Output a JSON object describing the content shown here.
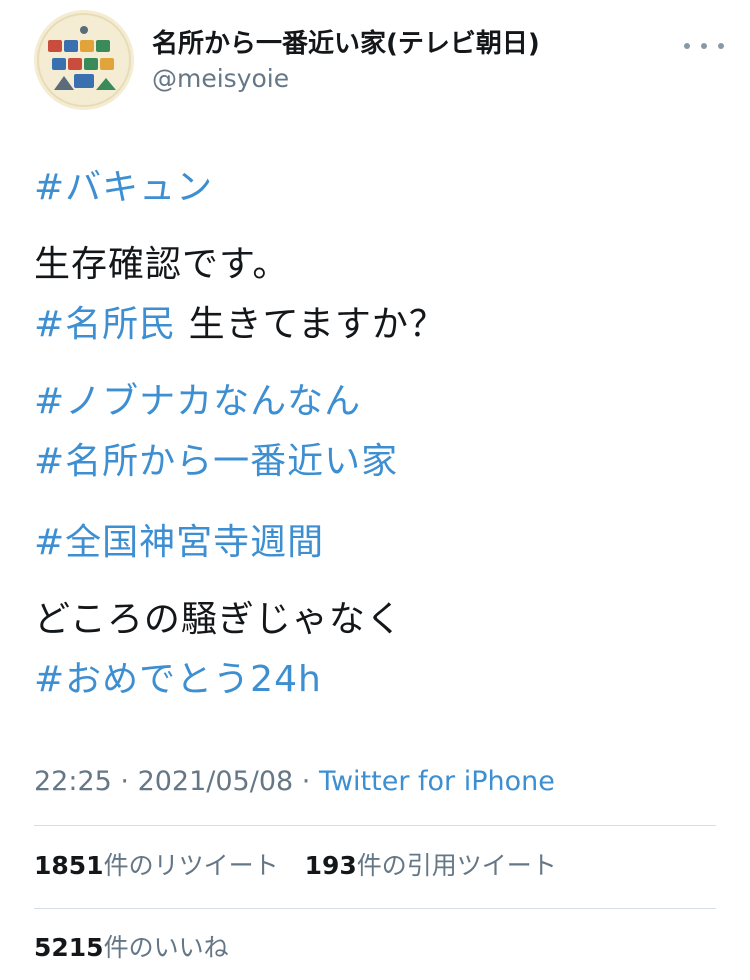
{
  "account": {
    "display_name": "名所から一番近い家(テレビ朝日)",
    "handle": "@meisyoie",
    "avatar_text": "名所から一番近い家"
  },
  "tweet": {
    "hashtag_bakyun": "#バキュン",
    "line_seizon": "生存確認です。",
    "hashtag_meishomin": "#名所民",
    "line_ikitemasu": " 生きてますか？",
    "hashtag_nobunaga": "#ノブナカなんなん",
    "hashtag_meishokara": "#名所から一番近い家",
    "hashtag_zenkoku": "#全国神宮寺週間",
    "line_dokoro": "どころの騒ぎじゃなく",
    "hashtag_omedetou": "#おめでとう24h"
  },
  "meta": {
    "time": "22:25",
    "separator": " · ",
    "date": "2021/05/08",
    "separator2": " · ",
    "source": "Twitter for iPhone"
  },
  "stats": {
    "retweet_count": "1851",
    "retweet_label": "件のリツイート",
    "quote_count": "193",
    "quote_label": "件の引用ツイート",
    "like_count": "5215",
    "like_label": "件のいいね"
  },
  "colors": {
    "link": "#3d8fd1",
    "text": "#14171a",
    "secondary": "#657786"
  },
  "icons": {
    "more": "more-horizontal-icon"
  }
}
